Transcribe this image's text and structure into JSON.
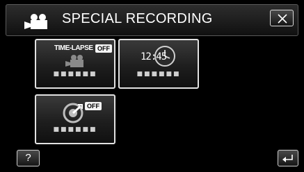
{
  "header": {
    "title": "SPECIAL RECORDING",
    "title_icon": "movie-camera-icon",
    "close_icon": "close-x-icon"
  },
  "tiles": [
    {
      "label": "TIME-LAPSE",
      "badge": "OFF",
      "caption": "■■■■■■",
      "icon": "movie-camera-icon"
    },
    {
      "clock_text": "12:45",
      "caption": "■■■■■■",
      "icon": "clock-icon"
    },
    {
      "badge": "OFF",
      "caption": "■■■■■■",
      "icon": "timer-icon"
    }
  ],
  "footer": {
    "help_label": "?",
    "back_icon": "return-arrow-icon"
  },
  "colors": {
    "background": "#000000",
    "tile_border": "#e2e2e2",
    "text": "#ffffff"
  }
}
